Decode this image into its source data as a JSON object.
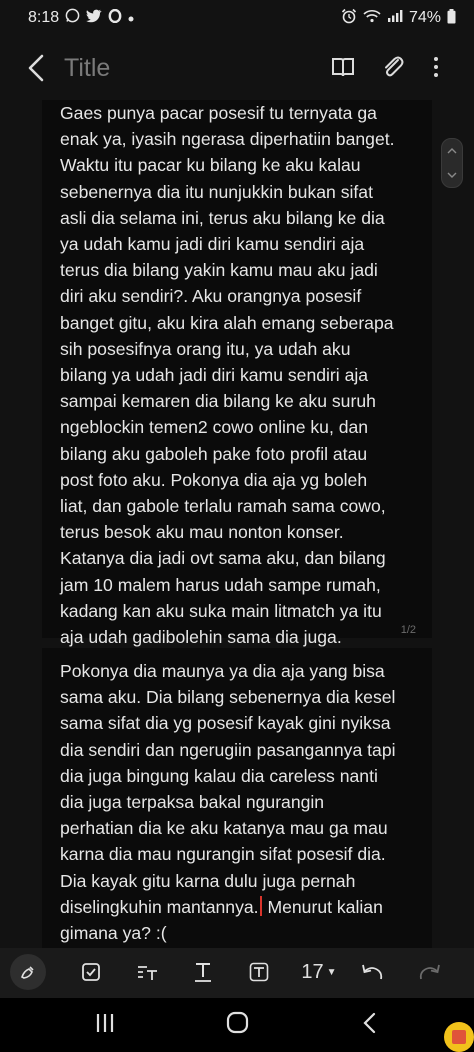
{
  "status_bar": {
    "time": "8:18",
    "battery": "74%"
  },
  "app_bar": {
    "title": "Title"
  },
  "document": {
    "page1_text": "Gaes punya pacar posesif tu ternyata ga\nenak ya, iyasih ngerasa diperhatiin banget.\nWaktu itu pacar ku bilang ke aku kalau\nsebenernya dia itu nunjukkin bukan sifat\nasli dia selama ini, terus aku bilang ke dia\nya udah kamu jadi diri kamu sendiri aja\nterus dia bilang yakin kamu mau aku jadi\ndiri aku sendiri?. Aku orangnya posesif\nbanget gitu, aku kira alah emang seberapa\nsih posesifnya orang itu, ya udah aku\nbilang ya udah jadi diri kamu sendiri aja\nsampai kemaren dia bilang ke aku suruh\nngeblockin temen2 cowo online ku, dan\nbilang aku gaboleh pake foto profil atau\npost foto aku. Pokonya dia aja yg boleh\nliat, dan gabole terlalu ramah sama cowo,\nterus besok aku mau nonton konser.\nKatanya dia jadi ovt sama aku, dan bilang\njam 10 malem harus udah sampe rumah,\nkadang kan aku suka main litmatch ya itu\naja udah gadibolehin sama dia juga.",
    "page1_number": "1/2",
    "page2_text_before_cursor": "Pokonya dia maunya ya dia aja yang bisa\nsama aku. Dia bilang sebenernya dia kesel\nsama sifat dia yg posesif kayak gini nyiksa\ndia sendiri dan ngerugiin pasangannya tapi\ndia juga bingung kalau dia careless nanti\ndia juga terpaksa bakal ngurangin\nperhatian dia ke aku katanya mau ga mau\nkarna dia mau ngurangin sifat posesif dia.\nDia kayak gitu karna dulu juga pernah\ndiselingkuhin mantannya.",
    "page2_text_after_cursor": " Menurut kalian\ngimana ya? :("
  },
  "toolbar": {
    "font_size": "17"
  },
  "icons": {
    "back": "back-chevron-icon",
    "reader": "book-icon",
    "attach": "paperclip-icon",
    "more": "more-vertical-icon",
    "pen": "pen-icon",
    "checkbox": "checkbox-icon",
    "text_style": "text-style-icon",
    "text_format": "text-underline-icon",
    "text_box": "text-box-icon",
    "undo": "undo-icon",
    "redo": "redo-icon"
  },
  "colors": {
    "background": "#121212",
    "page": "#0b0b0b",
    "cursor": "#d9342b",
    "accent_fab": "#f2c21b"
  }
}
